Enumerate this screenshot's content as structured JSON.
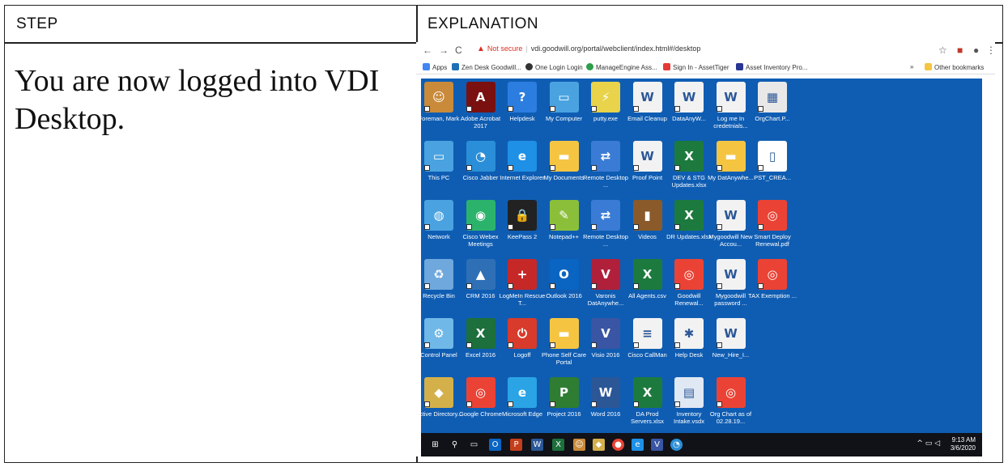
{
  "table": {
    "header_step": "Step",
    "header_explanation": "Explanation",
    "step_text": "You are now logged into VDI Desktop."
  },
  "browser": {
    "not_secure": "Not secure",
    "url": "vdi.goodwill.org/portal/webclient/index.html#/desktop",
    "bookmarks": [
      "Apps",
      "Zen Desk Goodwill...",
      "One Login Login",
      "ManageEngine Ass...",
      "Sign In - AssetTiger",
      "Asset Inventory Pro..."
    ],
    "other_bookmarks": "Other bookmarks"
  },
  "desktop": {
    "icons": [
      {
        "label": "Foreman, Mark",
        "icon": "user-icon",
        "color": "#c98a3a"
      },
      {
        "label": "Adobe Acrobat 2017",
        "icon": "acrobat-icon",
        "color": "#7a1010"
      },
      {
        "label": "Helpdesk",
        "icon": "help-icon",
        "color": "#2b7de0"
      },
      {
        "label": "My Computer",
        "icon": "computer-icon",
        "color": "#4aa3e0"
      },
      {
        "label": "putty.exe",
        "icon": "putty-icon",
        "color": "#e8d34a"
      },
      {
        "label": "Email Cleanup",
        "icon": "word-doc-icon",
        "color": "#f2f2f2"
      },
      {
        "label": "DataAnyW...",
        "icon": "word-doc-icon",
        "color": "#f2f2f2"
      },
      {
        "label": "Log me In credetnials...",
        "icon": "word-doc-icon",
        "color": "#f2f2f2"
      },
      {
        "label": "OrgChart.P...",
        "icon": "image-icon",
        "color": "#e8e8e8"
      },
      {
        "label": "This PC",
        "icon": "computer-icon",
        "color": "#4aa3e0"
      },
      {
        "label": "Cisco Jabber",
        "icon": "jabber-icon",
        "color": "#2a8fd8"
      },
      {
        "label": "Internet Explorer",
        "icon": "ie-icon",
        "color": "#1e90e6"
      },
      {
        "label": "My Documents",
        "icon": "folder-icon",
        "color": "#f5c542"
      },
      {
        "label": "Remote Desktop ...",
        "icon": "remote-desktop-icon",
        "color": "#3a7bd5"
      },
      {
        "label": "Proof Point",
        "icon": "word-doc-icon",
        "color": "#f2f2f2"
      },
      {
        "label": "DEV & STG Updates.xlsx",
        "icon": "excel-doc-icon",
        "color": "#1d7a3e"
      },
      {
        "label": "My DatAnywhe...",
        "icon": "folder-icon",
        "color": "#f5c542"
      },
      {
        "label": "PST_CREA...",
        "icon": "file-icon",
        "color": "#ffffff"
      },
      {
        "label": "Network",
        "icon": "network-icon",
        "color": "#4aa3e0"
      },
      {
        "label": "Cisco Webex Meetings",
        "icon": "webex-icon",
        "color": "#2cb36b"
      },
      {
        "label": "KeePass 2",
        "icon": "lock-icon",
        "color": "#222222"
      },
      {
        "label": "Notepad++",
        "icon": "notepad-icon",
        "color": "#8bbf3a"
      },
      {
        "label": "Remote Desktop ...",
        "icon": "remote-desktop-icon",
        "color": "#3a7bd5"
      },
      {
        "label": "Videos",
        "icon": "video-icon",
        "color": "#8a5a2a"
      },
      {
        "label": "DR Updates.xlsx",
        "icon": "excel-doc-icon",
        "color": "#1d7a3e"
      },
      {
        "label": "Mygoodwill New Accou...",
        "icon": "word-doc-icon",
        "color": "#f2f2f2"
      },
      {
        "label": "Smart Deploy Renewal.pdf",
        "icon": "chrome-icon",
        "color": "#ea4335"
      },
      {
        "label": "Recycle Bin",
        "icon": "recycle-bin-icon",
        "color": "#6fa8dc"
      },
      {
        "label": "CRM 2016",
        "icon": "crm-icon",
        "color": "#2f6fb5"
      },
      {
        "label": "LogMeIn Rescue T...",
        "icon": "logmein-icon",
        "color": "#c62828"
      },
      {
        "label": "Outlook 2016",
        "icon": "outlook-icon",
        "color": "#0a64c2"
      },
      {
        "label": "Varonis DatAnywhe...",
        "icon": "varonis-icon",
        "color": "#b0203a"
      },
      {
        "label": "All Agents.csv",
        "icon": "csv-icon",
        "color": "#1d7a3e"
      },
      {
        "label": "Goodwill Renewal...",
        "icon": "chrome-icon",
        "color": "#ea4335"
      },
      {
        "label": "Mygoodwill password ...",
        "icon": "word-doc-icon",
        "color": "#f2f2f2"
      },
      {
        "label": "TAX Exemption ...",
        "icon": "chrome-icon",
        "color": "#ea4335"
      },
      {
        "label": "Control Panel",
        "icon": "control-panel-icon",
        "color": "#6fb8e8"
      },
      {
        "label": "Excel 2016",
        "icon": "excel-icon",
        "color": "#1d6f3b"
      },
      {
        "label": "Logoff",
        "icon": "power-icon",
        "color": "#d83b2b"
      },
      {
        "label": "Phone Self Care Portal",
        "icon": "folder-icon",
        "color": "#f5c542"
      },
      {
        "label": "Visio 2016",
        "icon": "visio-icon",
        "color": "#3955a3"
      },
      {
        "label": "Cisco CallMan",
        "icon": "cisco-doc-icon",
        "color": "#f2f2f2"
      },
      {
        "label": "Help Desk",
        "icon": "helpdesk-doc-icon",
        "color": "#f2f2f2"
      },
      {
        "label": "New_Hire_I...",
        "icon": "word-doc-icon",
        "color": "#f2f2f2"
      },
      {
        "label": "Active Directory...",
        "icon": "active-directory-icon",
        "color": "#d4b04a"
      },
      {
        "label": "Google Chrome",
        "icon": "chrome-icon",
        "color": "#ea4335"
      },
      {
        "label": "Microsoft Edge",
        "icon": "edge-icon",
        "color": "#2aa4e4"
      },
      {
        "label": "Project 2016",
        "icon": "project-icon",
        "color": "#2e7d32"
      },
      {
        "label": "Word 2016",
        "icon": "word-icon",
        "color": "#2b5797"
      },
      {
        "label": "DA Prod Servers.xlsx",
        "icon": "excel-doc-icon",
        "color": "#1d7a3e"
      },
      {
        "label": "Inventory Intake.vsdx",
        "icon": "diagram-icon",
        "color": "#e0e8f4"
      },
      {
        "label": "Org Chart as of 02.28.19...",
        "icon": "chrome-icon",
        "color": "#ea4335"
      }
    ]
  },
  "taskbar": {
    "time": "9:13 AM",
    "date": "3/6/2020"
  }
}
